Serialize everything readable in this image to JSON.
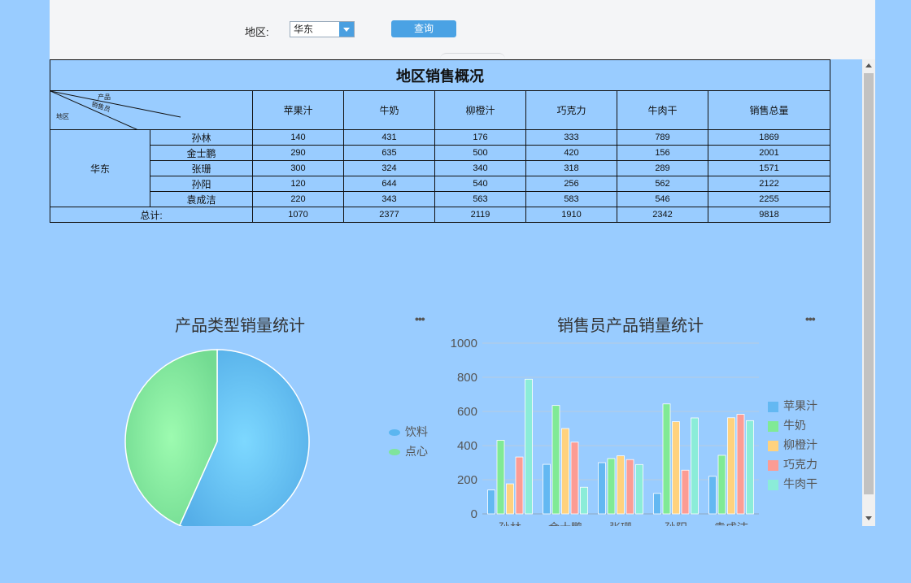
{
  "filter": {
    "region_label": "地区:",
    "region_value": "华东",
    "query_label": "查询"
  },
  "report": {
    "title": "地区销售概况",
    "corner": {
      "product": "产品",
      "salesperson": "销售员",
      "region": "地区"
    },
    "columns": [
      "苹果汁",
      "牛奶",
      "柳橙汁",
      "巧克力",
      "牛肉干",
      "销售总量"
    ],
    "region": "华东",
    "rows": [
      {
        "name": "孙林",
        "values": [
          "140",
          "431",
          "176",
          "333",
          "789",
          "1869"
        ]
      },
      {
        "name": "金士鹏",
        "values": [
          "290",
          "635",
          "500",
          "420",
          "156",
          "2001"
        ]
      },
      {
        "name": "张珊",
        "values": [
          "300",
          "324",
          "340",
          "318",
          "289",
          "1571"
        ]
      },
      {
        "name": "孙阳",
        "values": [
          "120",
          "644",
          "540",
          "256",
          "562",
          "2122"
        ]
      },
      {
        "name": "袁成洁",
        "values": [
          "220",
          "343",
          "563",
          "583",
          "546",
          "2255"
        ]
      }
    ],
    "total": {
      "label": "总计:",
      "values": [
        "1070",
        "2377",
        "2119",
        "1910",
        "2342",
        "9818"
      ]
    }
  },
  "chart_data": [
    {
      "type": "pie",
      "title": "产品类型销量统计",
      "labels": [
        "饮料",
        "点心"
      ],
      "values": [
        5566,
        4252
      ],
      "colors": [
        "#5bb6f0",
        "#7fe49c"
      ],
      "legend": "right"
    },
    {
      "type": "bar",
      "title": "销售员产品销量统计",
      "categories": [
        "孙林",
        "金士鹏",
        "张珊",
        "孙阳",
        "袁成洁"
      ],
      "series": [
        {
          "name": "苹果汁",
          "values": [
            140,
            290,
            300,
            120,
            220
          ],
          "color": "#63b8f2"
        },
        {
          "name": "牛奶",
          "values": [
            431,
            635,
            324,
            644,
            343
          ],
          "color": "#80ea95"
        },
        {
          "name": "柳橙汁",
          "values": [
            176,
            500,
            340,
            540,
            563
          ],
          "color": "#ffd27e"
        },
        {
          "name": "巧克力",
          "values": [
            333,
            420,
            318,
            256,
            583
          ],
          "color": "#fc9c94"
        },
        {
          "name": "牛肉干",
          "values": [
            789,
            156,
            289,
            562,
            546
          ],
          "color": "#8becd8"
        }
      ],
      "ylim": [
        0,
        1000
      ],
      "yticks": [
        0,
        200,
        400,
        600,
        800,
        1000
      ],
      "grid": true,
      "legend": "right"
    }
  ]
}
